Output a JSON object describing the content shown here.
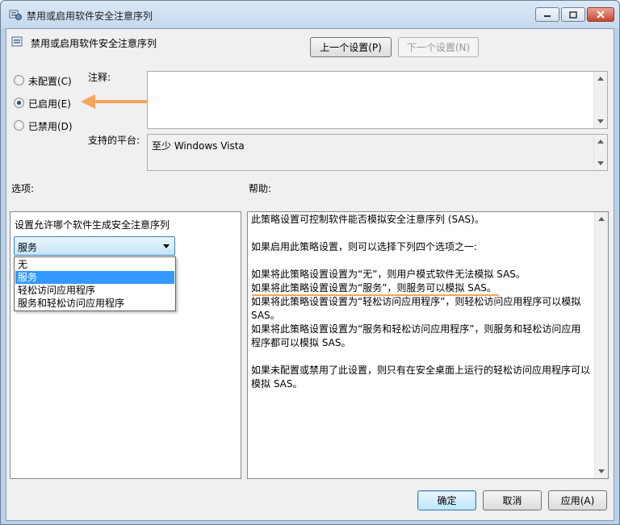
{
  "window": {
    "title": "禁用或启用软件安全注意序列",
    "controls": [
      "minimize",
      "maximize",
      "close"
    ]
  },
  "header": {
    "policy_name": "禁用或启用软件安全注意序列",
    "prev_setting_label": "上一个设置(P)",
    "next_setting_label": "下一个设置(N)"
  },
  "state": {
    "options": [
      {
        "label": "未配置(C)",
        "checked": false
      },
      {
        "label": "已启用(E)",
        "checked": true
      },
      {
        "label": "已禁用(D)",
        "checked": false
      }
    ]
  },
  "comment": {
    "label": "注释:",
    "value": ""
  },
  "platform": {
    "label": "支持的平台:",
    "value": "至少 Windows Vista"
  },
  "options_panel": {
    "title": "选项:",
    "prompt": "设置允许哪个软件生成安全注意序列",
    "selected": "服务",
    "dropdown_items": [
      "无",
      "服务",
      "轻松访问应用程序",
      "服务和轻松访问应用程序"
    ]
  },
  "help_panel": {
    "title": "帮助:",
    "lines": [
      "此策略设置可控制软件能否模拟安全注意序列 (SAS)。",
      "",
      "如果启用此策略设置，则可以选择下列四个选项之一:",
      "",
      "如果将此策略设置设置为“无”，则用户模式软件无法模拟 SAS。",
      "如果将此策略设置设置为“服务”，则服务可以模拟 SAS。",
      "如果将此策略设置设置为“轻松访问应用程序”，则轻松访问应用程序可以模拟",
      "SAS。",
      "如果将此策略设置设置为“服务和轻松访问应用程序”，则服务和轻松访问应用",
      "程序都可以模拟 SAS。",
      "",
      "如果未配置或禁用了此设置，则只有在安全桌面上运行的轻松访问应用程序可以",
      "模拟 SAS。"
    ]
  },
  "footer": {
    "ok_label": "确定",
    "cancel_label": "取消",
    "apply_label": "应用(A)"
  },
  "colors": {
    "annotation": "#f5a55a",
    "selection": "#3399ff"
  }
}
